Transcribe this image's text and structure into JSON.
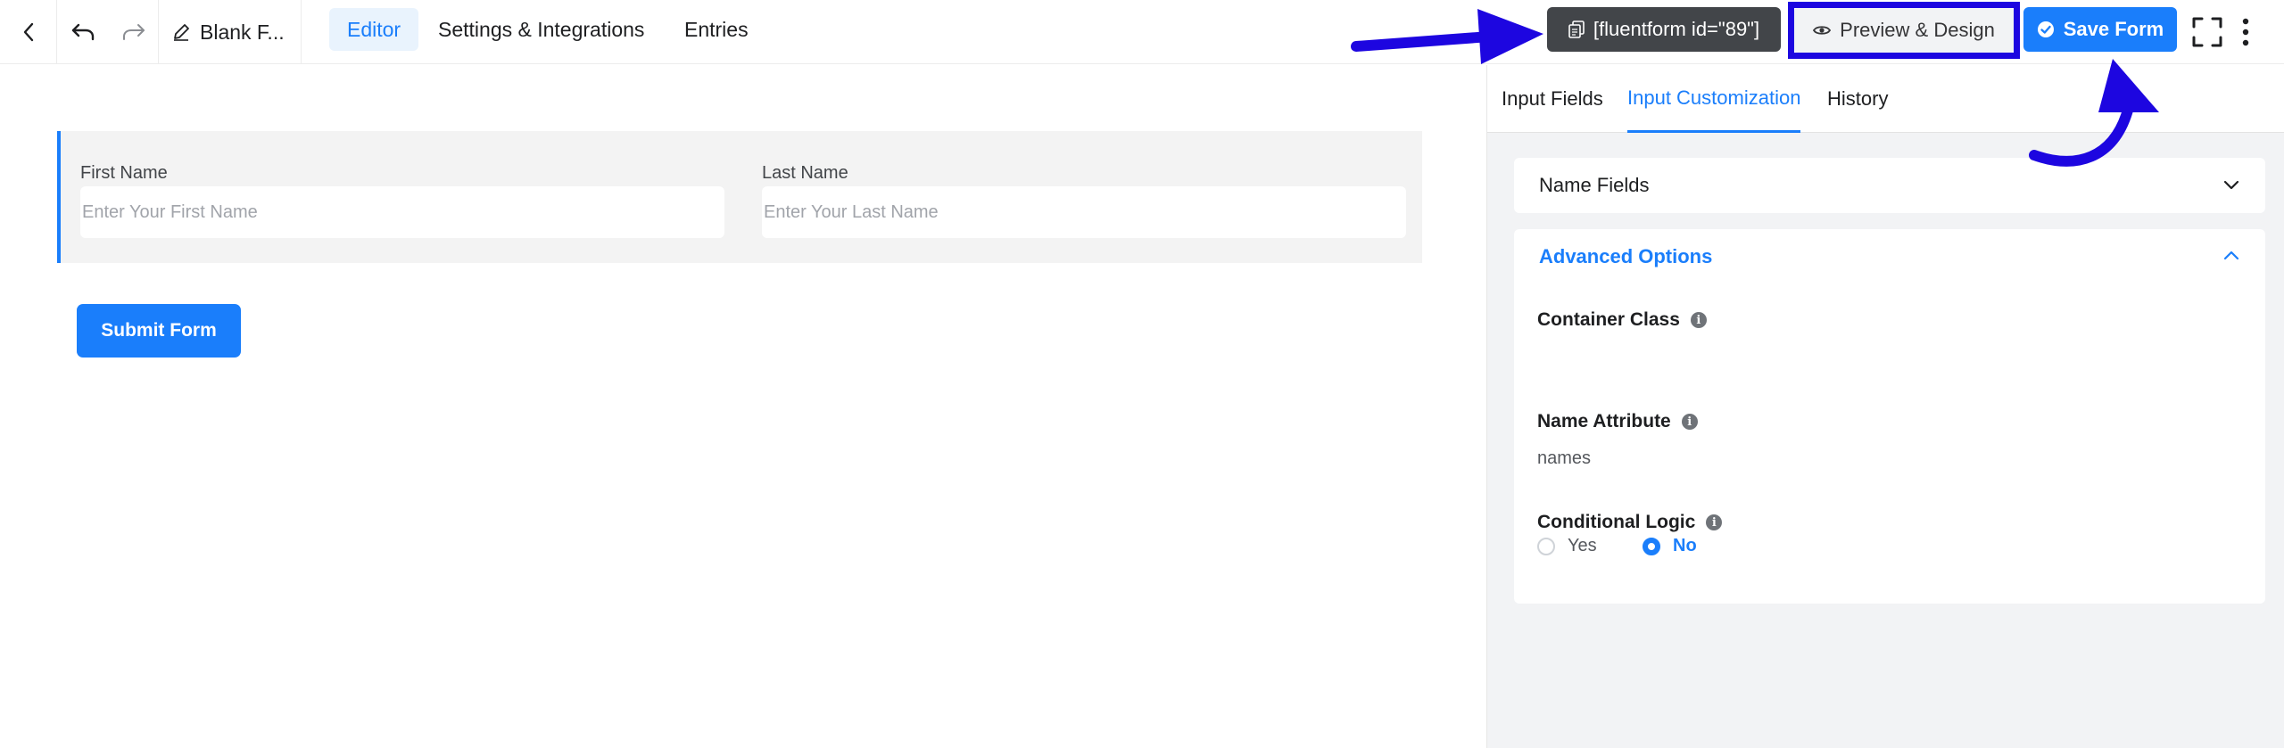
{
  "topbar": {
    "form_title": "Blank F...",
    "nav_tabs": [
      "Editor",
      "Settings & Integrations",
      "Entries"
    ],
    "shortcode": "[fluentform id=\"89\"]",
    "preview_label": "Preview & Design",
    "save_label": "Save Form"
  },
  "canvas": {
    "first_name_label": "First Name",
    "first_name_placeholder": "Enter Your First Name",
    "last_name_label": "Last Name",
    "last_name_placeholder": "Enter Your Last Name",
    "submit_label": "Submit Form"
  },
  "panel": {
    "tabs": [
      "Input Fields",
      "Input Customization",
      "History"
    ],
    "active_tab": "Input Customization",
    "name_fields_title": "Name Fields",
    "advanced_title": "Advanced Options",
    "container_class_label": "Container Class",
    "name_attribute_label": "Name Attribute",
    "name_attribute_value": "names",
    "conditional_logic_label": "Conditional Logic",
    "conditional_options": [
      "Yes",
      "No"
    ],
    "conditional_selected": "No"
  },
  "colors": {
    "accent": "#1a7efb",
    "annotation": "#1d06e0",
    "shortcode_bg": "#424549"
  }
}
